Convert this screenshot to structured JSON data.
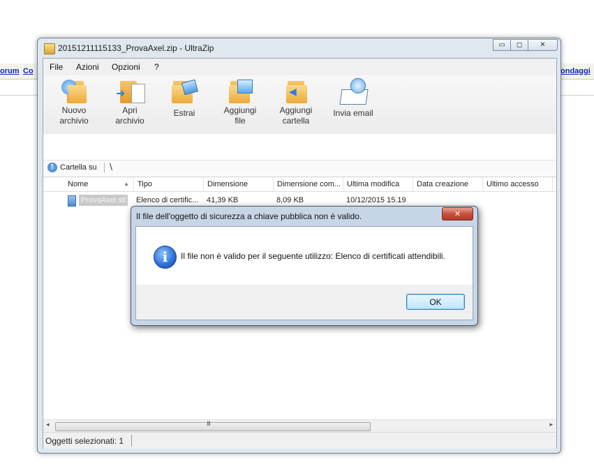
{
  "background": {
    "links": [
      "orum",
      "Co",
      "ondaggi"
    ]
  },
  "window": {
    "title": "20151211115133_ProvaAxel.zip - UltraZip",
    "controls": {
      "minimize": "▭",
      "maximize": "◻",
      "close": "✕"
    }
  },
  "menu": [
    "File",
    "Azioni",
    "Opzioni",
    "?"
  ],
  "toolbar": [
    {
      "label": "Nuovo\narchivio",
      "icon": "new-archive-icon"
    },
    {
      "label": "Apri\narchivio",
      "icon": "open-archive-icon"
    },
    {
      "label": "Estrai",
      "icon": "extract-icon"
    },
    {
      "label": "Aggiungi\nfile",
      "icon": "add-file-icon"
    },
    {
      "label": "Aggiungi\ncartella",
      "icon": "add-folder-icon"
    },
    {
      "label": "Invia email",
      "icon": "email-icon"
    }
  ],
  "address": {
    "up_label": "Cartella su",
    "path": "\\"
  },
  "columns": [
    "Nome",
    "Tipo",
    "Dimensione",
    "Dimensione com...",
    "Ultima modifica",
    "Data creazione",
    "Ultimo accesso"
  ],
  "files": [
    {
      "name": "ProvaAxel.stl",
      "type": "Elenco di certific...",
      "size": "41,39 KB",
      "compressed": "8,09 KB",
      "modified": "10/12/2015 15.19",
      "created": "",
      "accessed": ""
    }
  ],
  "scrollbar": {
    "left_arrow": "◂",
    "right_arrow": "▸",
    "grip": "III"
  },
  "status": {
    "text": "Oggetti selezionati:  1"
  },
  "dialog": {
    "title": "Il file dell'oggetto di sicurezza a chiave pubblica non è valido.",
    "close": "✕",
    "icon": "info-icon",
    "message": "Il file non è valido per il seguente utilizzo: Elenco di certificati attendibili.",
    "ok": "OK"
  },
  "colors": {
    "accent": "#2a6fd6",
    "dialog_frame": "#c7d6e6",
    "close_red": "#c9503d"
  }
}
